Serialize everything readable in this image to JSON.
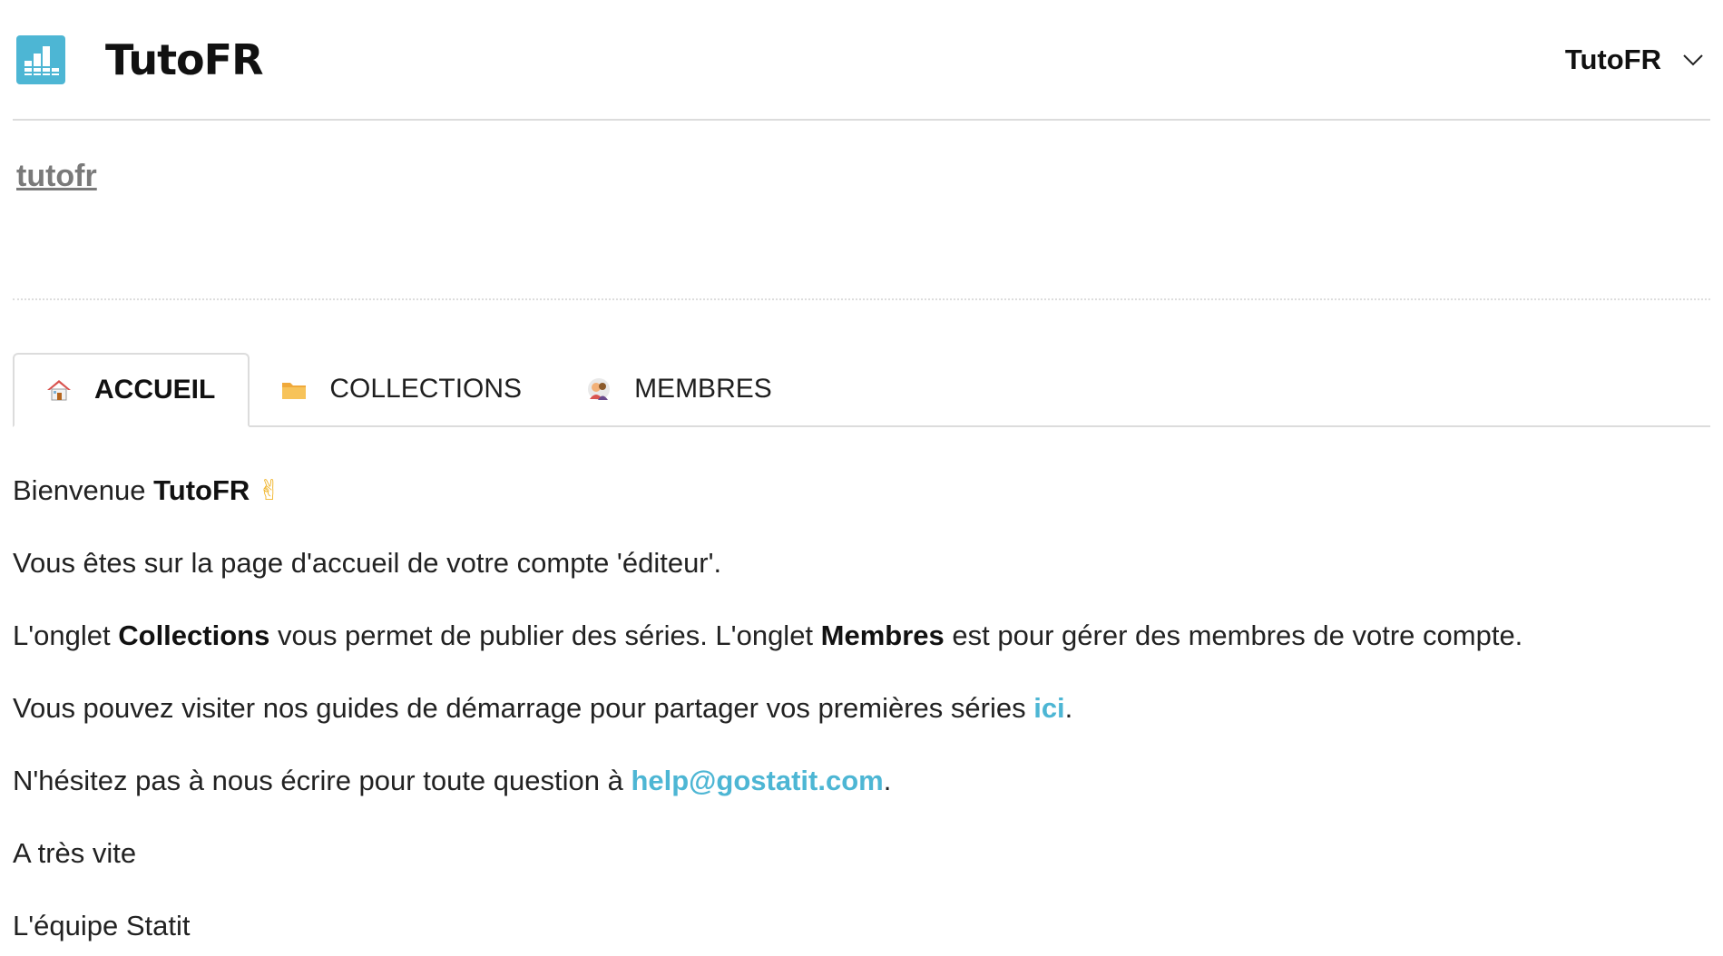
{
  "header": {
    "brand_title": "TutoFR",
    "account_name": "TutoFR",
    "logo_icon": "bar-chart-icon",
    "accent_color": "#4db6d4"
  },
  "org": {
    "name": "tutofr"
  },
  "tabs": [
    {
      "label": "ACCUEIL",
      "icon": "house-icon",
      "active": true
    },
    {
      "label": "COLLECTIONS",
      "icon": "folder-icon",
      "active": false
    },
    {
      "label": "MEMBRES",
      "icon": "people-icon",
      "active": false
    }
  ],
  "content": {
    "welcome_prefix": "Bienvenue ",
    "welcome_name": "TutoFR",
    "welcome_emoji": "✌",
    "line1": "Vous êtes sur la page d'accueil de votre compte 'éditeur'.",
    "line2_a": "L'onglet ",
    "line2_b": "Collections",
    "line2_c": " vous permet de publier des séries. L'onglet ",
    "line2_d": "Membres",
    "line2_e": " est pour gérer des membres de votre compte.",
    "line3_a": "Vous pouvez visiter nos guides de démarrage pour partager vos premières séries ",
    "line3_link": "ici",
    "line3_end": ".",
    "line4_a": "N'hésitez pas à nous écrire pour toute question à ",
    "line4_link": "help@gostatit.com",
    "line4_end": ".",
    "line5": "A très vite",
    "line6": "L'équipe Statit"
  }
}
